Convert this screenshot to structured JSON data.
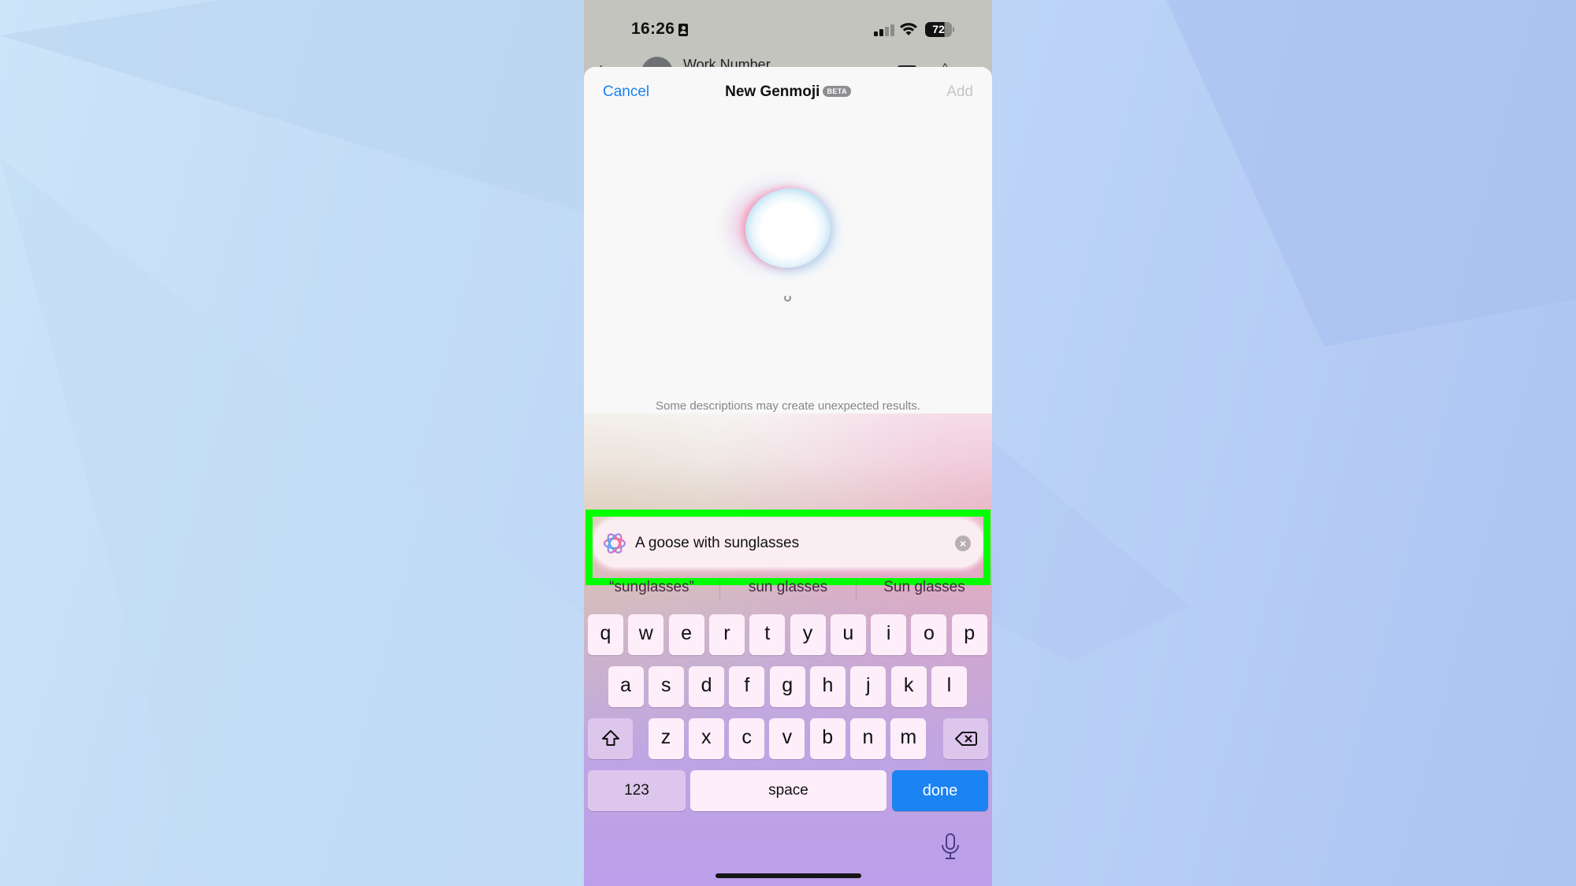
{
  "status_bar": {
    "time": "16:26",
    "battery": "72",
    "icons": [
      "focus-id-icon",
      "cellular-signal-icon",
      "wifi-icon",
      "battery-icon"
    ]
  },
  "background_screen": {
    "contact_name": "Work Number",
    "icons": [
      "back-chevron-icon",
      "contact-avatar",
      "video-call-icon",
      "info-icon"
    ]
  },
  "sheet": {
    "cancel_label": "Cancel",
    "title": "New Genmoji",
    "badge": "BETA",
    "add_label": "Add",
    "disclaimer": "Some descriptions may create unexpected results."
  },
  "prompt_field": {
    "value": "A goose with sunglasses",
    "clear_glyph": "×"
  },
  "suggestions": [
    "“sunglasses”",
    "sun glasses",
    "Sun glasses"
  ],
  "keyboard": {
    "row1": [
      "q",
      "w",
      "e",
      "r",
      "t",
      "y",
      "u",
      "i",
      "o",
      "p"
    ],
    "row2": [
      "a",
      "s",
      "d",
      "f",
      "g",
      "h",
      "j",
      "k",
      "l"
    ],
    "row3": [
      "z",
      "x",
      "c",
      "v",
      "b",
      "n",
      "m"
    ],
    "numbers_label": "123",
    "space_label": "space",
    "done_label": "done"
  },
  "colors": {
    "accent": "#1a82f0",
    "done_key": "#1b83f2",
    "highlight_box": "#00ff00"
  }
}
